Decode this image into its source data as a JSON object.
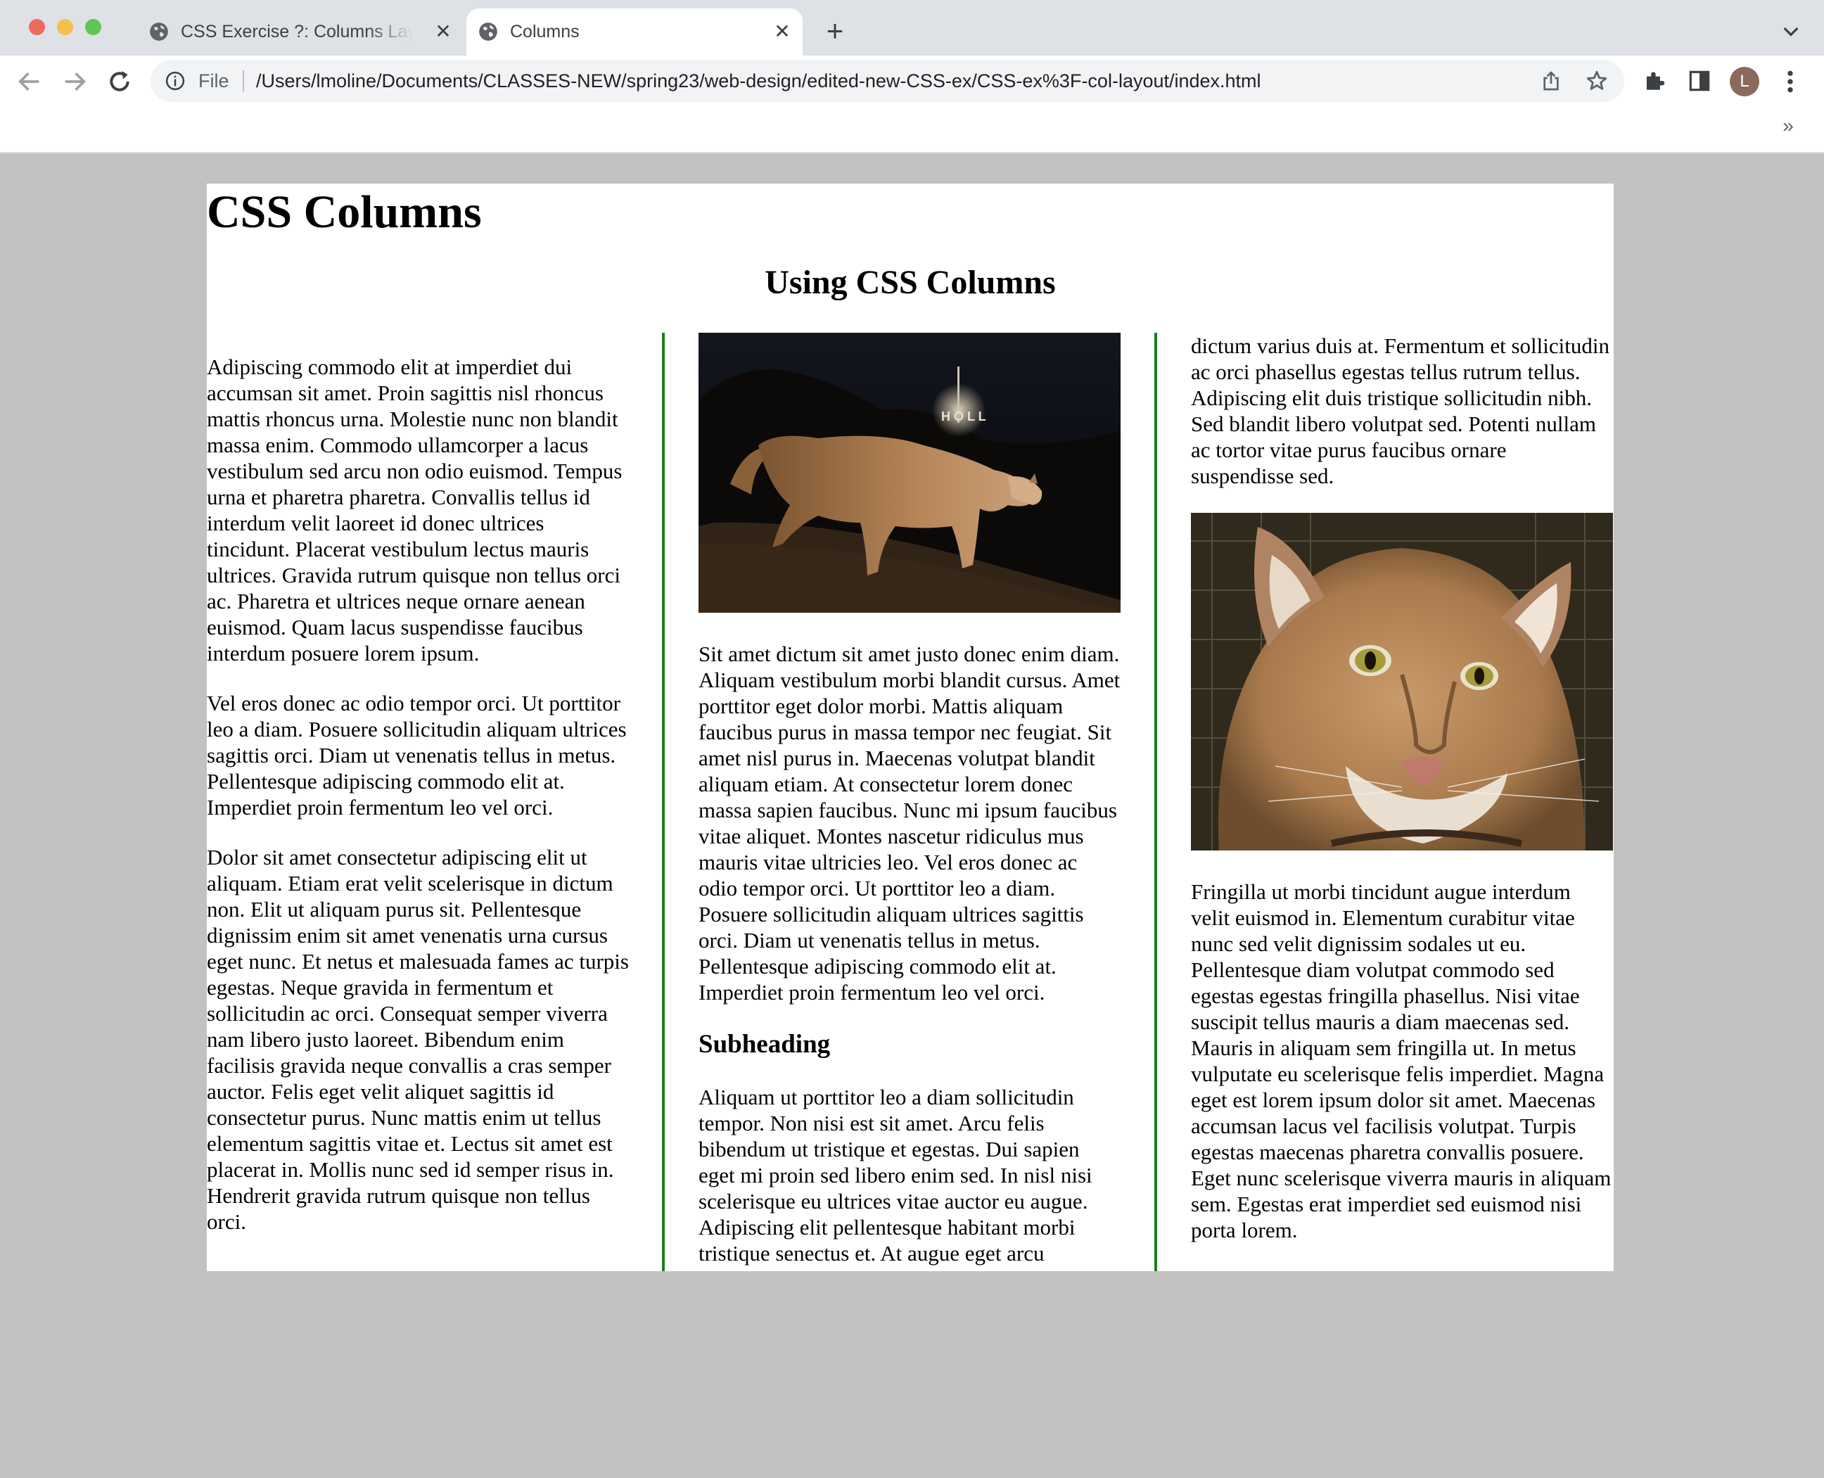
{
  "browser": {
    "tabs": [
      {
        "title": "CSS Exercise ?: Columns Layout",
        "active": false
      },
      {
        "title": "Columns",
        "active": true
      }
    ],
    "address_bar": {
      "scheme_label": "File",
      "url": "/Users/lmoline/Documents/CLASSES-NEW/spring23/web-design/edited-new-CSS-ex/CSS-ex%3F-col-layout/index.html"
    },
    "profile_initial": "L",
    "icons": [
      "back-icon",
      "forward-icon",
      "reload-icon",
      "info-icon",
      "share-icon",
      "star-icon",
      "extensions-icon",
      "side-panel-icon",
      "menu-icon",
      "new-tab-icon",
      "tab-search-icon",
      "bookmarks-overflow-icon"
    ]
  },
  "page": {
    "title": "CSS Columns",
    "section_heading": "Using CSS Columns",
    "colors": {
      "page_background": "#c2c2c2",
      "column_rule": "#1e7d1e",
      "container": "#ffffff"
    },
    "column1": [
      "Adipiscing commodo elit at imperdiet dui accumsan sit amet. Proin sagittis nisl rhoncus mattis rhoncus urna. Molestie nunc non blandit massa enim. Commodo ullamcorper a lacus vestibulum sed arcu non odio euismod. Tempus urna et pharetra pharetra. Convallis tellus id interdum velit laoreet id donec ultrices tincidunt. Placerat vestibulum lectus mauris ultrices. Gravida rutrum quisque non tellus orci ac. Pharetra et ultrices neque ornare aenean euismod. Quam lacus suspendisse faucibus interdum posuere lorem ipsum.",
      "Vel eros donec ac odio tempor orci. Ut porttitor leo a diam. Posuere sollicitudin aliquam ultrices sagittis orci. Diam ut venenatis tellus in metus. Pellentesque adipiscing commodo elit at. Imperdiet proin fermentum leo vel orci.",
      "Dolor sit amet consectetur adipiscing elit ut aliquam. Etiam erat velit scelerisque in dictum non. Elit ut aliquam purus sit. Pellentesque dignissim enim sit amet venenatis urna cursus eget nunc. Et netus et malesuada fames ac turpis egestas. Neque gravida in fermentum et sollicitudin ac orci. Consequat semper viverra nam libero justo laoreet. Bibendum enim facilisis gravida neque convallis a cras semper auctor. Felis eget velit aliquet sagittis id consectetur purus. Nunc mattis enim ut tellus elementum sagittis vitae et. Lectus sit amet est placerat in. Mollis nunc sed id semper risus in. Hendrerit gravida rutrum quisque non tellus orci."
    ],
    "column2": {
      "paragraph1": "Sit amet dictum sit amet justo donec enim diam. Aliquam vestibulum morbi blandit cursus. Amet porttitor eget dolor morbi. Mattis aliquam faucibus purus in massa tempor nec feugiat. Sit amet nisl purus in. Maecenas volutpat blandit aliquam etiam. At consectetur lorem donec massa sapien faucibus. Nunc mi ipsum faucibus vitae aliquet. Montes nascetur ridiculus mus mauris vitae ultricies leo. Vel eros donec ac odio tempor orci. Ut porttitor leo a diam. Posuere sollicitudin aliquam ultrices sagittis orci. Diam ut venenatis tellus in metus. Pellentesque adipiscing commodo elit at. Imperdiet proin fermentum leo vel orci.",
      "subheading": "Subheading",
      "paragraph2": "Aliquam ut porttitor leo a diam sollicitudin tempor. Non nisi est sit amet. Arcu felis bibendum ut tristique et egestas. Dui sapien eget mi proin sed libero enim sed. In nisl nisi scelerisque eu ultrices vitae auctor eu augue. Adipiscing elit pellentesque habitant morbi tristique senectus et. At augue eget arcu"
    },
    "column3": {
      "paragraph1": "dictum varius duis at. Fermentum et sollicitudin ac orci phasellus egestas tellus rutrum tellus. Adipiscing elit duis tristique sollicitudin nibh. Sed blandit libero volutpat sed. Potenti nullam ac tortor vitae purus faucibus ornare suspendisse sed.",
      "paragraph2": "Fringilla ut morbi tincidunt augue interdum velit euismod in. Elementum curabitur vitae nunc sed velit dignissim sodales ut eu. Pellentesque diam volutpat commodo sed egestas egestas fringilla phasellus. Nisi vitae suscipit tellus mauris a diam maecenas sed. Mauris in aliquam sem fringilla ut. In metus vulputate eu scelerisque felis imperdiet. Magna eget est lorem ipsum dolor sit amet. Maecenas accumsan lacus vel facilisis volutpat. Turpis egestas maecenas pharetra convallis posuere. Eget nunc scelerisque viverra mauris in aliquam sem. Egestas erat imperdiet sed euismod nisi porta lorem."
    }
  }
}
